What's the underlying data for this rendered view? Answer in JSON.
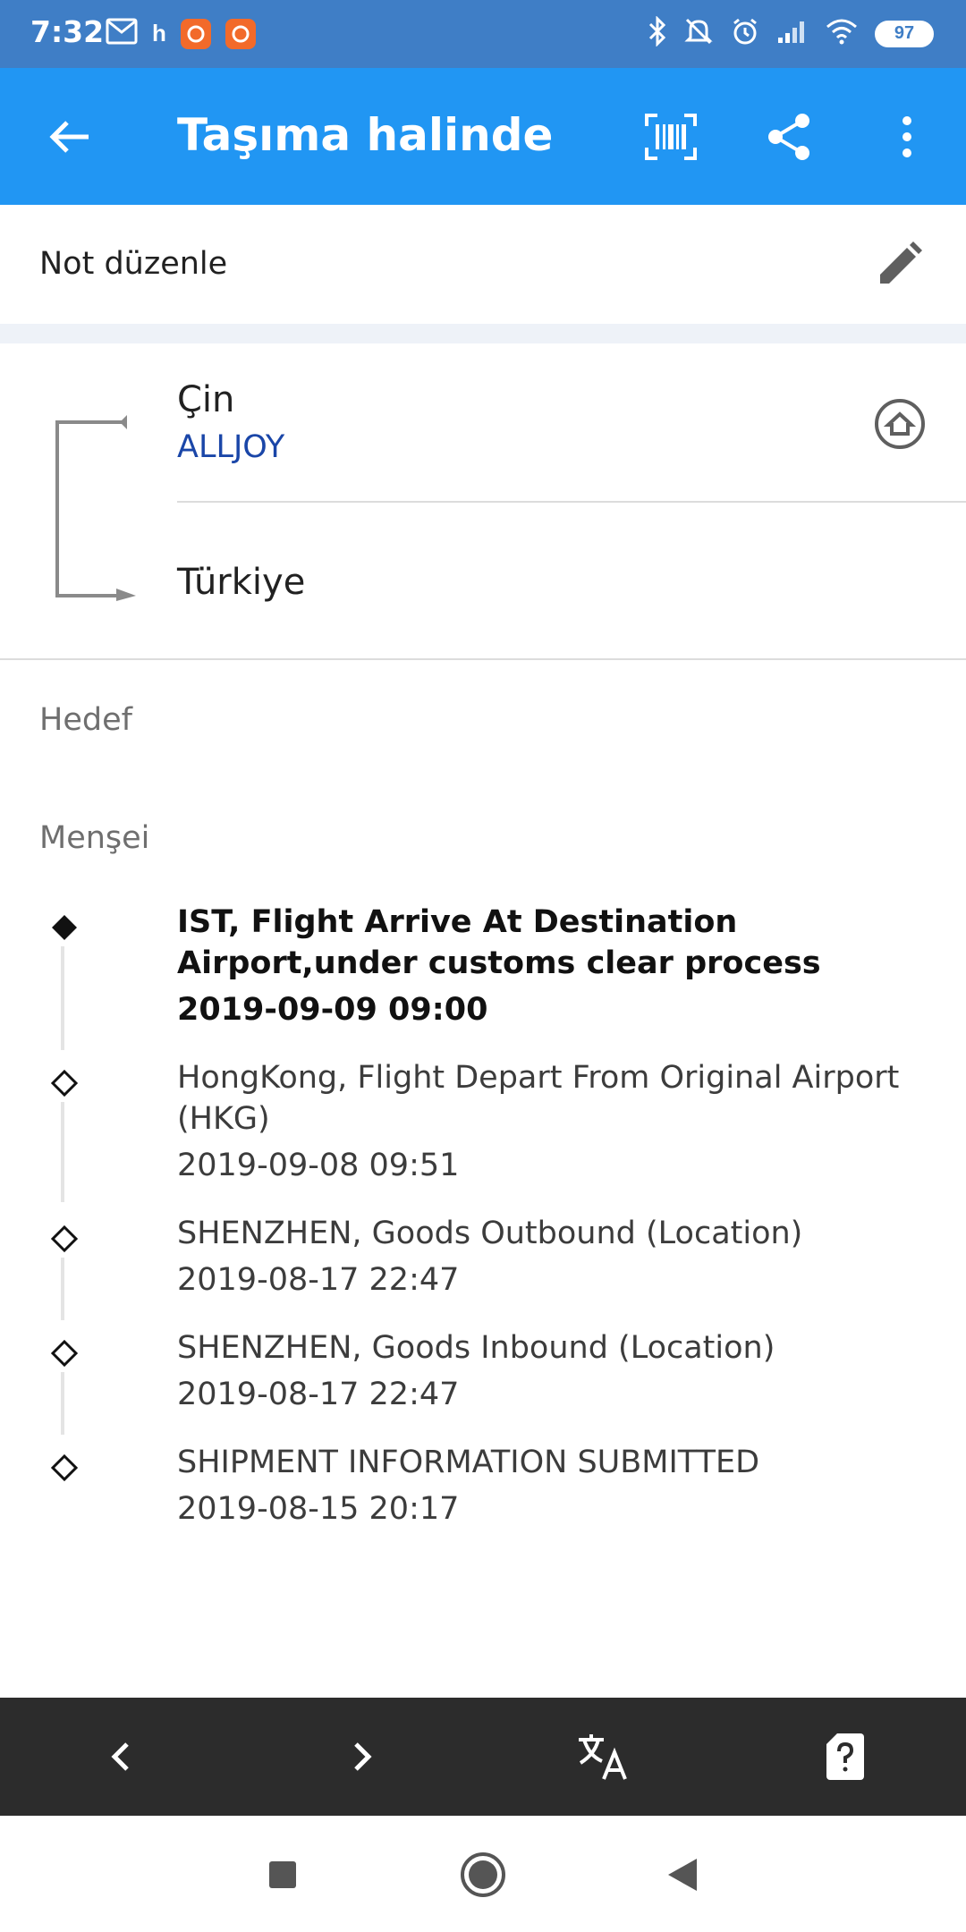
{
  "status_bar": {
    "time": "7:32",
    "carrier_glyph": "h",
    "battery": "97",
    "icons": [
      "gmail-icon",
      "app-notification-icon",
      "app-notification-icon",
      "bluetooth-icon",
      "mute-icon",
      "alarm-icon",
      "signal-icon",
      "wifi-icon",
      "battery-icon"
    ]
  },
  "app_bar": {
    "title": "Taşıma halinde",
    "actions": [
      "barcode-icon",
      "share-icon",
      "more-vert-icon"
    ]
  },
  "note": {
    "label": "Not düzenle"
  },
  "route": {
    "from": "Çin",
    "carrier": "ALLJOY",
    "to": "Türkiye"
  },
  "sections": {
    "destination": "Hedef",
    "origin": "Menşei"
  },
  "events": [
    {
      "text": "IST, Flight Arrive At Destination Airport,under customs clear process",
      "date": "2019-09-09 09:00",
      "latest": true
    },
    {
      "text": "HongKong, Flight Depart From Original Airport (HKG)",
      "date": "2019-09-08 09:51",
      "latest": false
    },
    {
      "text": "SHENZHEN, Goods Outbound (Location)",
      "date": "2019-08-17 22:47",
      "latest": false
    },
    {
      "text": "SHENZHEN, Goods Inbound (Location)",
      "date": "2019-08-17 22:47",
      "latest": false
    },
    {
      "text": "SHIPMENT INFORMATION SUBMITTED",
      "date": "2019-08-15 20:17",
      "latest": false
    }
  ],
  "toolbar": {
    "icons": [
      "chevron-left-icon",
      "chevron-right-icon",
      "translate-icon",
      "help-card-icon"
    ]
  },
  "colors": {
    "status_bar": "#3f7ec6",
    "app_bar": "#2196f3",
    "carrier_link": "#1a46a8",
    "toolbar": "#2c2c2c"
  }
}
